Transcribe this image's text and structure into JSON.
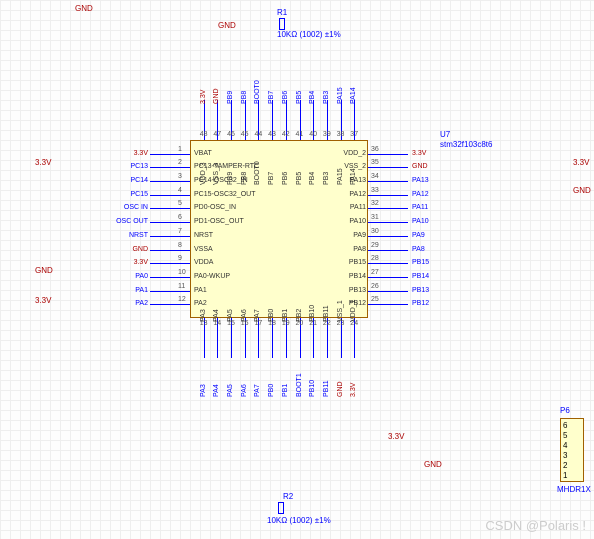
{
  "component": {
    "designator": "U7",
    "part": "stm32f103c8t6"
  },
  "pins_top": [
    {
      "num": "48",
      "name": "VDD_3",
      "net": "3.3V"
    },
    {
      "num": "47",
      "name": "VSS_3",
      "net": "GND"
    },
    {
      "num": "46",
      "name": "PB9",
      "net": "PB9"
    },
    {
      "num": "45",
      "name": "PB8",
      "net": "PB8"
    },
    {
      "num": "44",
      "name": "BOOT0",
      "net": "BOOT0"
    },
    {
      "num": "43",
      "name": "PB7",
      "net": "PB7"
    },
    {
      "num": "42",
      "name": "PB6",
      "net": "PB6"
    },
    {
      "num": "41",
      "name": "PB5",
      "net": "PB5"
    },
    {
      "num": "40",
      "name": "PB4",
      "net": "PB4"
    },
    {
      "num": "39",
      "name": "PB3",
      "net": "PB3"
    },
    {
      "num": "38",
      "name": "PA15",
      "net": "PA15"
    },
    {
      "num": "37",
      "name": "PA14",
      "net": "PA14"
    }
  ],
  "pins_left": [
    {
      "num": "1",
      "name": "VBAT",
      "net": "3.3V"
    },
    {
      "num": "2",
      "name": "PC13-TAMPER-RTC",
      "net": "PC13"
    },
    {
      "num": "3",
      "name": "PC14-OSC32_IN",
      "net": "PC14"
    },
    {
      "num": "4",
      "name": "PC15-OSC32_OUT",
      "net": "PC15"
    },
    {
      "num": "5",
      "name": "PD0-OSC_IN",
      "net": "OSC IN"
    },
    {
      "num": "6",
      "name": "PD1-OSC_OUT",
      "net": "OSC OUT"
    },
    {
      "num": "7",
      "name": "NRST",
      "net": "NRST"
    },
    {
      "num": "8",
      "name": "VSSA",
      "net": "GND"
    },
    {
      "num": "9",
      "name": "VDDA",
      "net": "3.3V"
    },
    {
      "num": "10",
      "name": "PA0-WKUP",
      "net": "PA0"
    },
    {
      "num": "11",
      "name": "PA1",
      "net": "PA1"
    },
    {
      "num": "12",
      "name": "PA2",
      "net": "PA2"
    }
  ],
  "pins_right": [
    {
      "num": "36",
      "name": "VDD_2",
      "net": "3.3V"
    },
    {
      "num": "35",
      "name": "VSS_2",
      "net": "GND"
    },
    {
      "num": "34",
      "name": "PA13",
      "net": "PA13"
    },
    {
      "num": "33",
      "name": "PA12",
      "net": "PA12"
    },
    {
      "num": "32",
      "name": "PA11",
      "net": "PA11"
    },
    {
      "num": "31",
      "name": "PA10",
      "net": "PA10"
    },
    {
      "num": "30",
      "name": "PA9",
      "net": "PA9"
    },
    {
      "num": "29",
      "name": "PA8",
      "net": "PA8"
    },
    {
      "num": "28",
      "name": "PB15",
      "net": "PB15"
    },
    {
      "num": "27",
      "name": "PB14",
      "net": "PB14"
    },
    {
      "num": "26",
      "name": "PB13",
      "net": "PB13"
    },
    {
      "num": "25",
      "name": "PB12",
      "net": "PB12"
    }
  ],
  "pins_bottom": [
    {
      "num": "13",
      "name": "PA3",
      "net": "PA3"
    },
    {
      "num": "14",
      "name": "PA4",
      "net": "PA4"
    },
    {
      "num": "15",
      "name": "PA5",
      "net": "PA5"
    },
    {
      "num": "16",
      "name": "PA6",
      "net": "PA6"
    },
    {
      "num": "17",
      "name": "PA7",
      "net": "PA7"
    },
    {
      "num": "18",
      "name": "PB0",
      "net": "PB0"
    },
    {
      "num": "19",
      "name": "PB1",
      "net": "PB1"
    },
    {
      "num": "20",
      "name": "PB2",
      "net": "BOOT1"
    },
    {
      "num": "21",
      "name": "PB10",
      "net": "PB10"
    },
    {
      "num": "22",
      "name": "PB11",
      "net": "PB11"
    },
    {
      "num": "23",
      "name": "VSS_1",
      "net": "GND"
    },
    {
      "num": "24",
      "name": "VDD_1",
      "net": "3.3V"
    }
  ],
  "resistors": {
    "r1": {
      "ref": "R1",
      "value": "10KΩ (1002) ±1%"
    },
    "r2": {
      "ref": "R2",
      "value": "10KΩ (1002) ±1%"
    }
  },
  "power_labels": {
    "v33": "3.3V",
    "gnd": "GND"
  },
  "connector": {
    "ref": "P6",
    "part": "MHDR1X",
    "pins": [
      "6",
      "5",
      "4",
      "3",
      "2",
      "1"
    ]
  },
  "watermark": "CSDN @Polaris !"
}
